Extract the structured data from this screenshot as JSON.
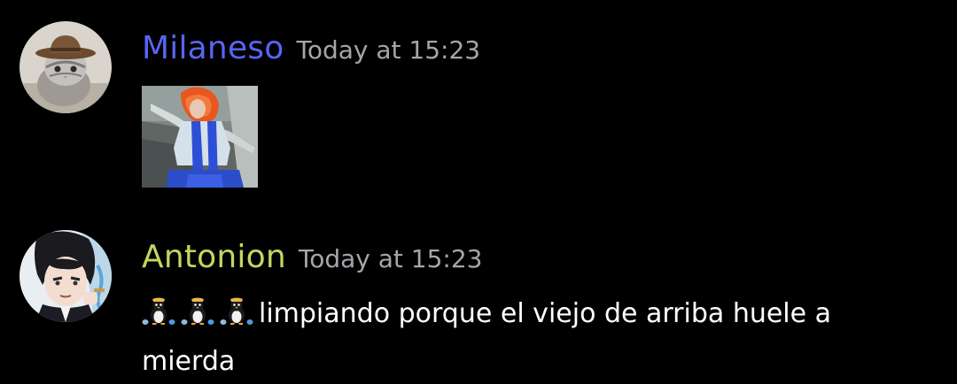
{
  "messages": [
    {
      "author": "Milaneso",
      "author_color": "#5865f2",
      "timestamp": "Today at 15:23",
      "avatar_icon": "cat-with-cowboy-hat-avatar",
      "attachment": "image-attachment-person-with-orange-hair"
    },
    {
      "author": "Antonion",
      "author_color": "#c3d660",
      "timestamp": "Today at 15:23",
      "avatar_icon": "anime-character-avatar",
      "emojis": [
        "cleaning-penguin-emoji",
        "cleaning-penguin-emoji",
        "cleaning-penguin-emoji"
      ],
      "text": "limpiando porque el viejo de arriba huele a mierda"
    }
  ],
  "colors": {
    "background": "#000000",
    "timestamp": "#a3a6aa",
    "text": "#ffffff"
  }
}
